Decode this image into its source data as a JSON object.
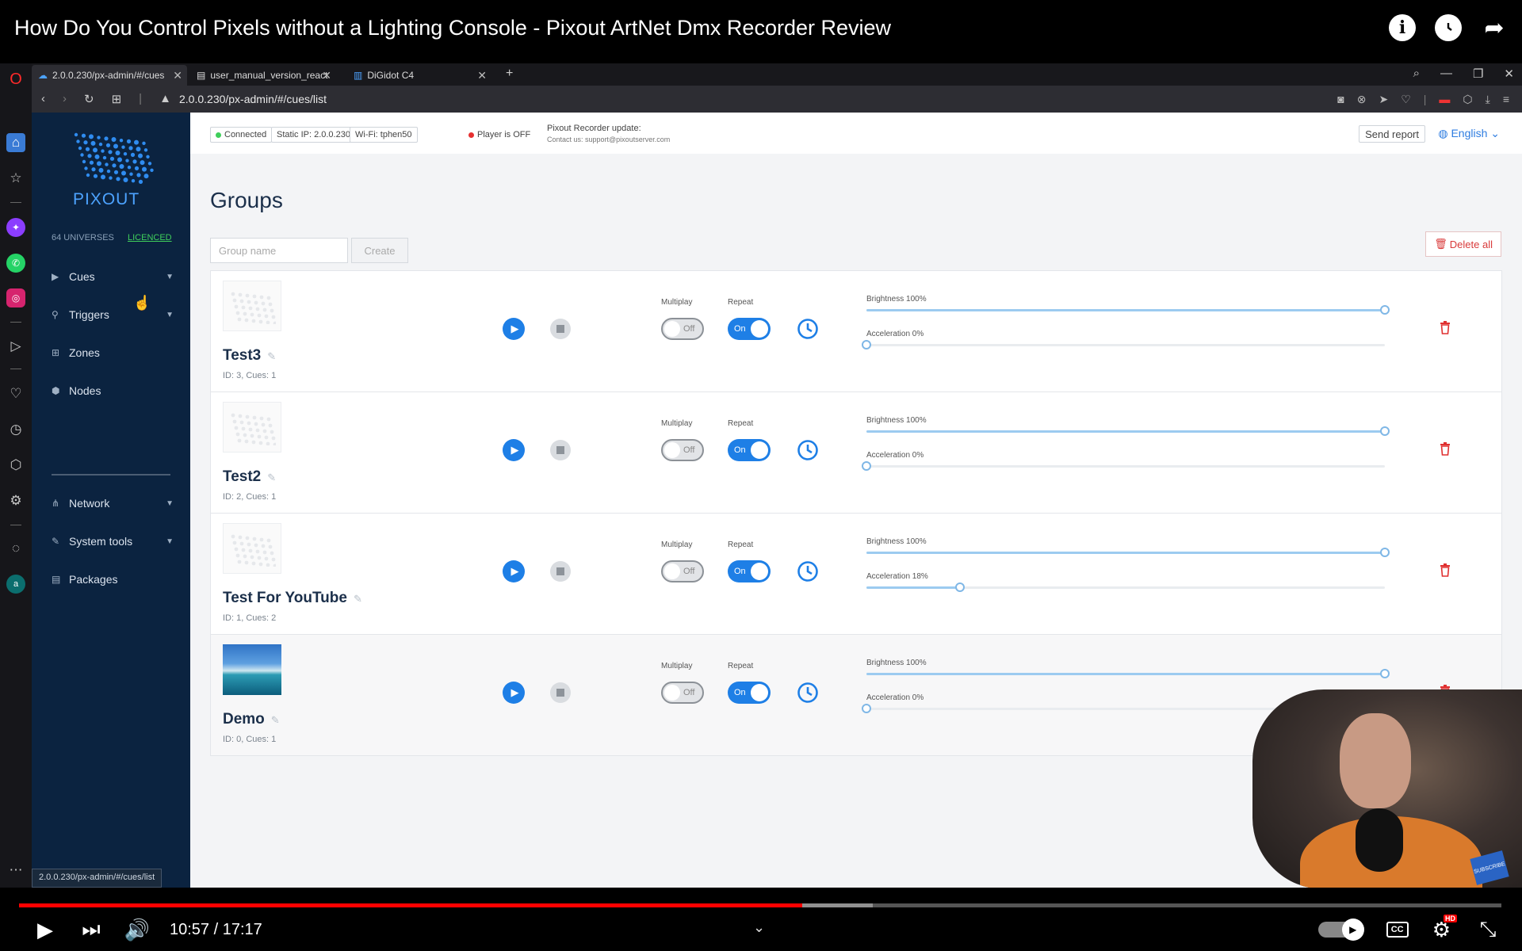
{
  "video": {
    "title": "How Do You Control Pixels without a Lighting Console - Pixout ArtNet Dmx Recorder Review",
    "time": "10:57 / 17:17",
    "played_fraction": 0.5285,
    "buffered_fraction": 0.576,
    "hd_badge": "HD",
    "cc_label": "CC",
    "subscribe_label": "SUBSCRIBE"
  },
  "browser": {
    "tabs": [
      {
        "label": "2.0.0.230/px-admin/#/cues"
      },
      {
        "label": "user_manual_version_react"
      },
      {
        "label": "DiGidot C4"
      }
    ],
    "url": "2.0.0.230/px-admin/#/cues/list",
    "status_url": "2.0.0.230/px-admin/#/cues/list"
  },
  "sidebar": {
    "logo_text": "PIXOUT",
    "universes": "64 UNIVERSES",
    "licence": "LICENCED",
    "items": [
      {
        "label": "Cues",
        "icon": "triangle-right-icon"
      },
      {
        "label": "Triggers",
        "icon": "link-icon"
      },
      {
        "label": "Zones",
        "icon": "grid-icon"
      },
      {
        "label": "Nodes",
        "icon": "nodes-icon"
      },
      {
        "label": "Network",
        "icon": "network-icon"
      },
      {
        "label": "System tools",
        "icon": "wrench-icon"
      },
      {
        "label": "Packages",
        "icon": "package-icon"
      }
    ]
  },
  "header": {
    "connected": "Connected",
    "static_ip": "Static IP: 2.0.0.230",
    "wifi": "Wi-Fi: tphen50",
    "player": "Player is OFF",
    "update_title": "Pixout Recorder update:",
    "update_contact": "Contact us: support@pixoutserver.com",
    "send_report": "Send report",
    "language": "English",
    "colors": {
      "connected": "#3fcf5b",
      "player_off": "#e63030"
    }
  },
  "page": {
    "title": "Groups",
    "group_name_placeholder": "Group name",
    "create_label": "Create",
    "delete_all_label": "Delete all"
  },
  "labels": {
    "multiplay": "Multiplay",
    "repeat": "Repeat",
    "off": "Off",
    "on": "On"
  },
  "groups": [
    {
      "name": "Test3",
      "meta": "ID: 3, Cues: 1",
      "brightness_label": "Brightness 100%",
      "brightness": 100,
      "acceleration_label": "Acceleration 0%",
      "acceleration": 0,
      "thumb": "placeholder"
    },
    {
      "name": "Test2",
      "meta": "ID: 2, Cues: 1",
      "brightness_label": "Brightness 100%",
      "brightness": 100,
      "acceleration_label": "Acceleration 0%",
      "acceleration": 0,
      "thumb": "placeholder"
    },
    {
      "name": "Test For YouTube",
      "meta": "ID: 1, Cues: 2",
      "brightness_label": "Brightness 100%",
      "brightness": 100,
      "acceleration_label": "Acceleration 18%",
      "acceleration": 18,
      "thumb": "placeholder"
    },
    {
      "name": "Demo",
      "meta": "ID: 0, Cues: 1",
      "brightness_label": "Brightness 100%",
      "brightness": 100,
      "acceleration_label": "Acceleration 0%",
      "acceleration": 0,
      "thumb": "beach-photo"
    }
  ]
}
